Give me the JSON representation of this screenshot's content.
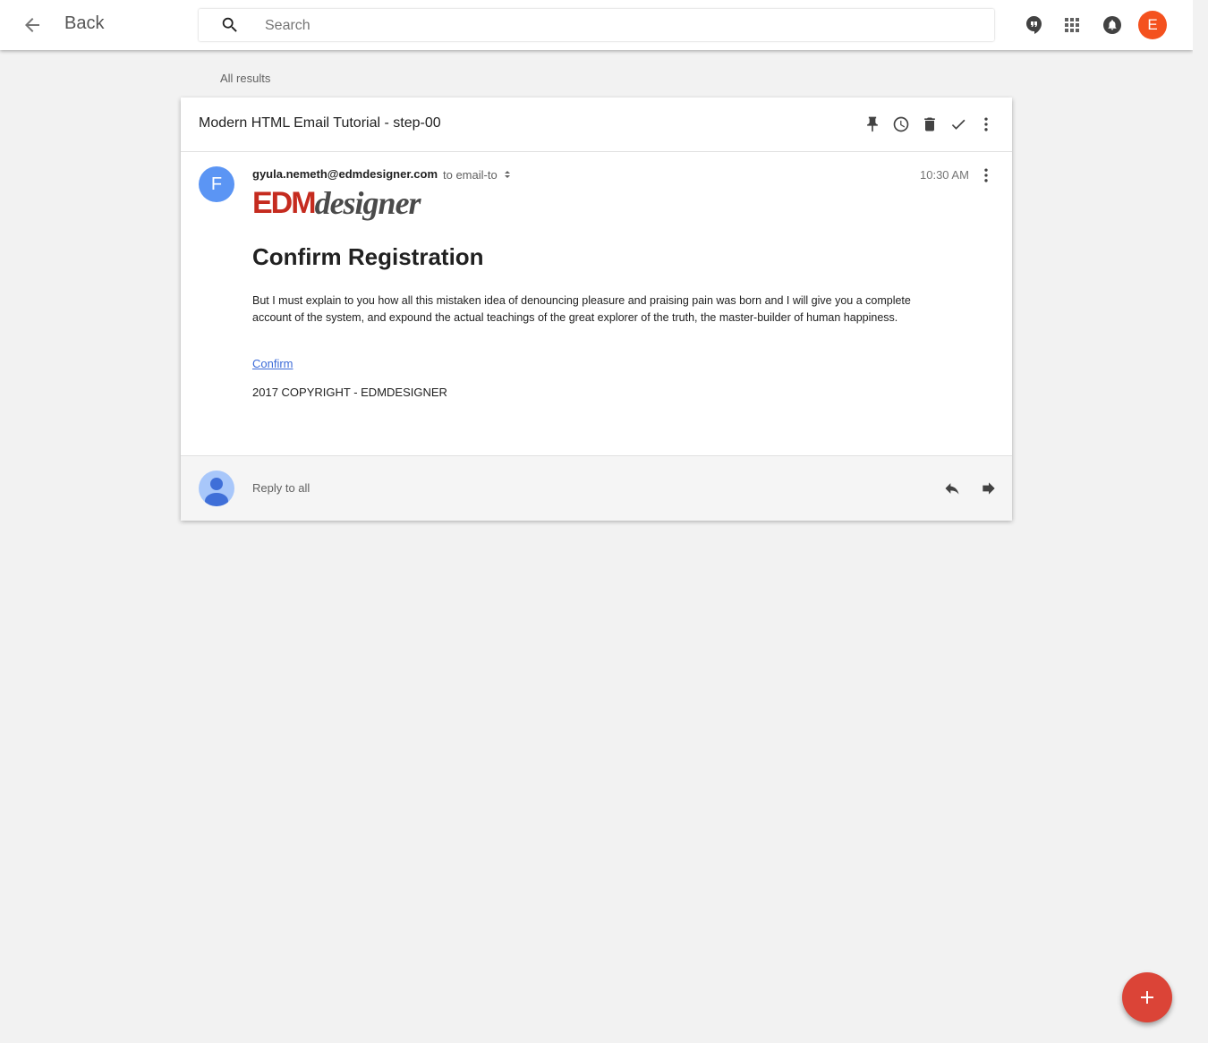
{
  "topbar": {
    "back_label": "Back",
    "search_placeholder": "Search",
    "account_initial": "E",
    "icons": [
      "back-arrow-icon",
      "search-icon",
      "hangouts-icon",
      "apps-grid-icon",
      "notifications-bell-icon"
    ]
  },
  "breadcrumb": {
    "label": "All results"
  },
  "thread": {
    "subject": "Modern HTML Email Tutorial - step-00",
    "actions": [
      "pin-icon",
      "snooze-clock-icon",
      "trash-icon",
      "done-check-icon",
      "more-vert-icon"
    ],
    "message": {
      "sender_initial": "F",
      "sender": "gyula.nemeth@edmdesigner.com",
      "to_text": "to email-to",
      "time": "10:30 AM",
      "logo": {
        "part1": "EDM",
        "part2": "designer"
      },
      "title": "Confirm Registration",
      "body": "But I must explain to you how all this mistaken idea of denouncing pleasure and praising pain was born and I will give you a complete account of the system, and expound the actual teachings of the great explorer of the truth, the master-builder of human happiness.",
      "link_label": "Confirm",
      "copyright": "2017 COPYRIGHT - EDMDESIGNER"
    },
    "reply": {
      "label": "Reply to all"
    }
  },
  "colors": {
    "background": "#f2f2f2",
    "account_avatar": "#f4511e",
    "sender_avatar": "#5b95f4",
    "logo_red": "#c52b1f",
    "link": "#3c6bd8",
    "fab": "#db4437"
  }
}
